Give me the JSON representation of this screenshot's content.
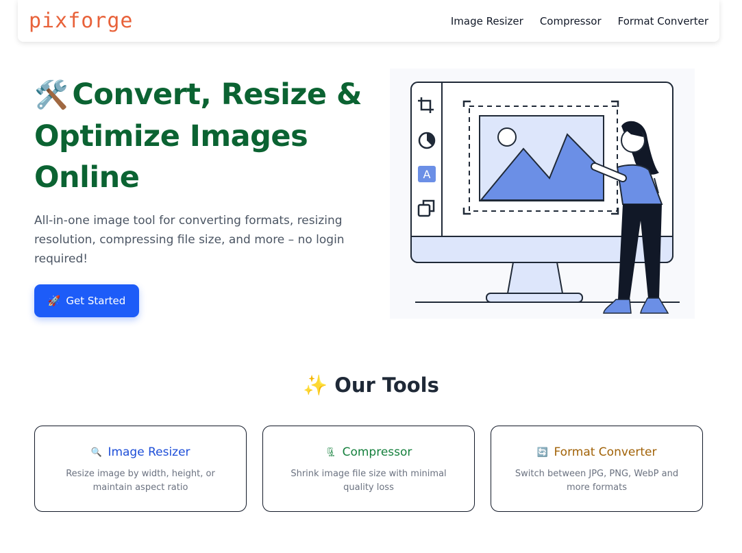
{
  "nav": {
    "brand": "pixforge",
    "links": [
      "Image Resizer",
      "Compressor",
      "Format Converter"
    ]
  },
  "hero": {
    "emoji": "🛠️",
    "title": "Convert, Resize & Optimize Images Online",
    "subtitle": "All-in-one image tool for converting formats, resizing resolution, compressing file size, and more – no login required!",
    "cta_icon": "🚀",
    "cta_label": "Get Started"
  },
  "tools": {
    "heading_emoji": "✨",
    "heading": "Our Tools",
    "cards": [
      {
        "icon": "🔍",
        "title": "Image Resizer",
        "desc": "Resize image by width, height, or maintain aspect ratio",
        "color": "#1d4ed8"
      },
      {
        "icon": "🗜",
        "title": "Compressor",
        "desc": "Shrink image file size with minimal quality loss",
        "color": "#15803d"
      },
      {
        "icon": "🔄",
        "title": "Format Converter",
        "desc": "Switch between JPG, PNG, WebP and more formats",
        "color": "#a16207"
      }
    ]
  },
  "colors": {
    "brand": "#e8623a",
    "hero_title": "#0b6332",
    "cta": "#1d5cf8",
    "illustration_accent": "#6b8fe6"
  }
}
